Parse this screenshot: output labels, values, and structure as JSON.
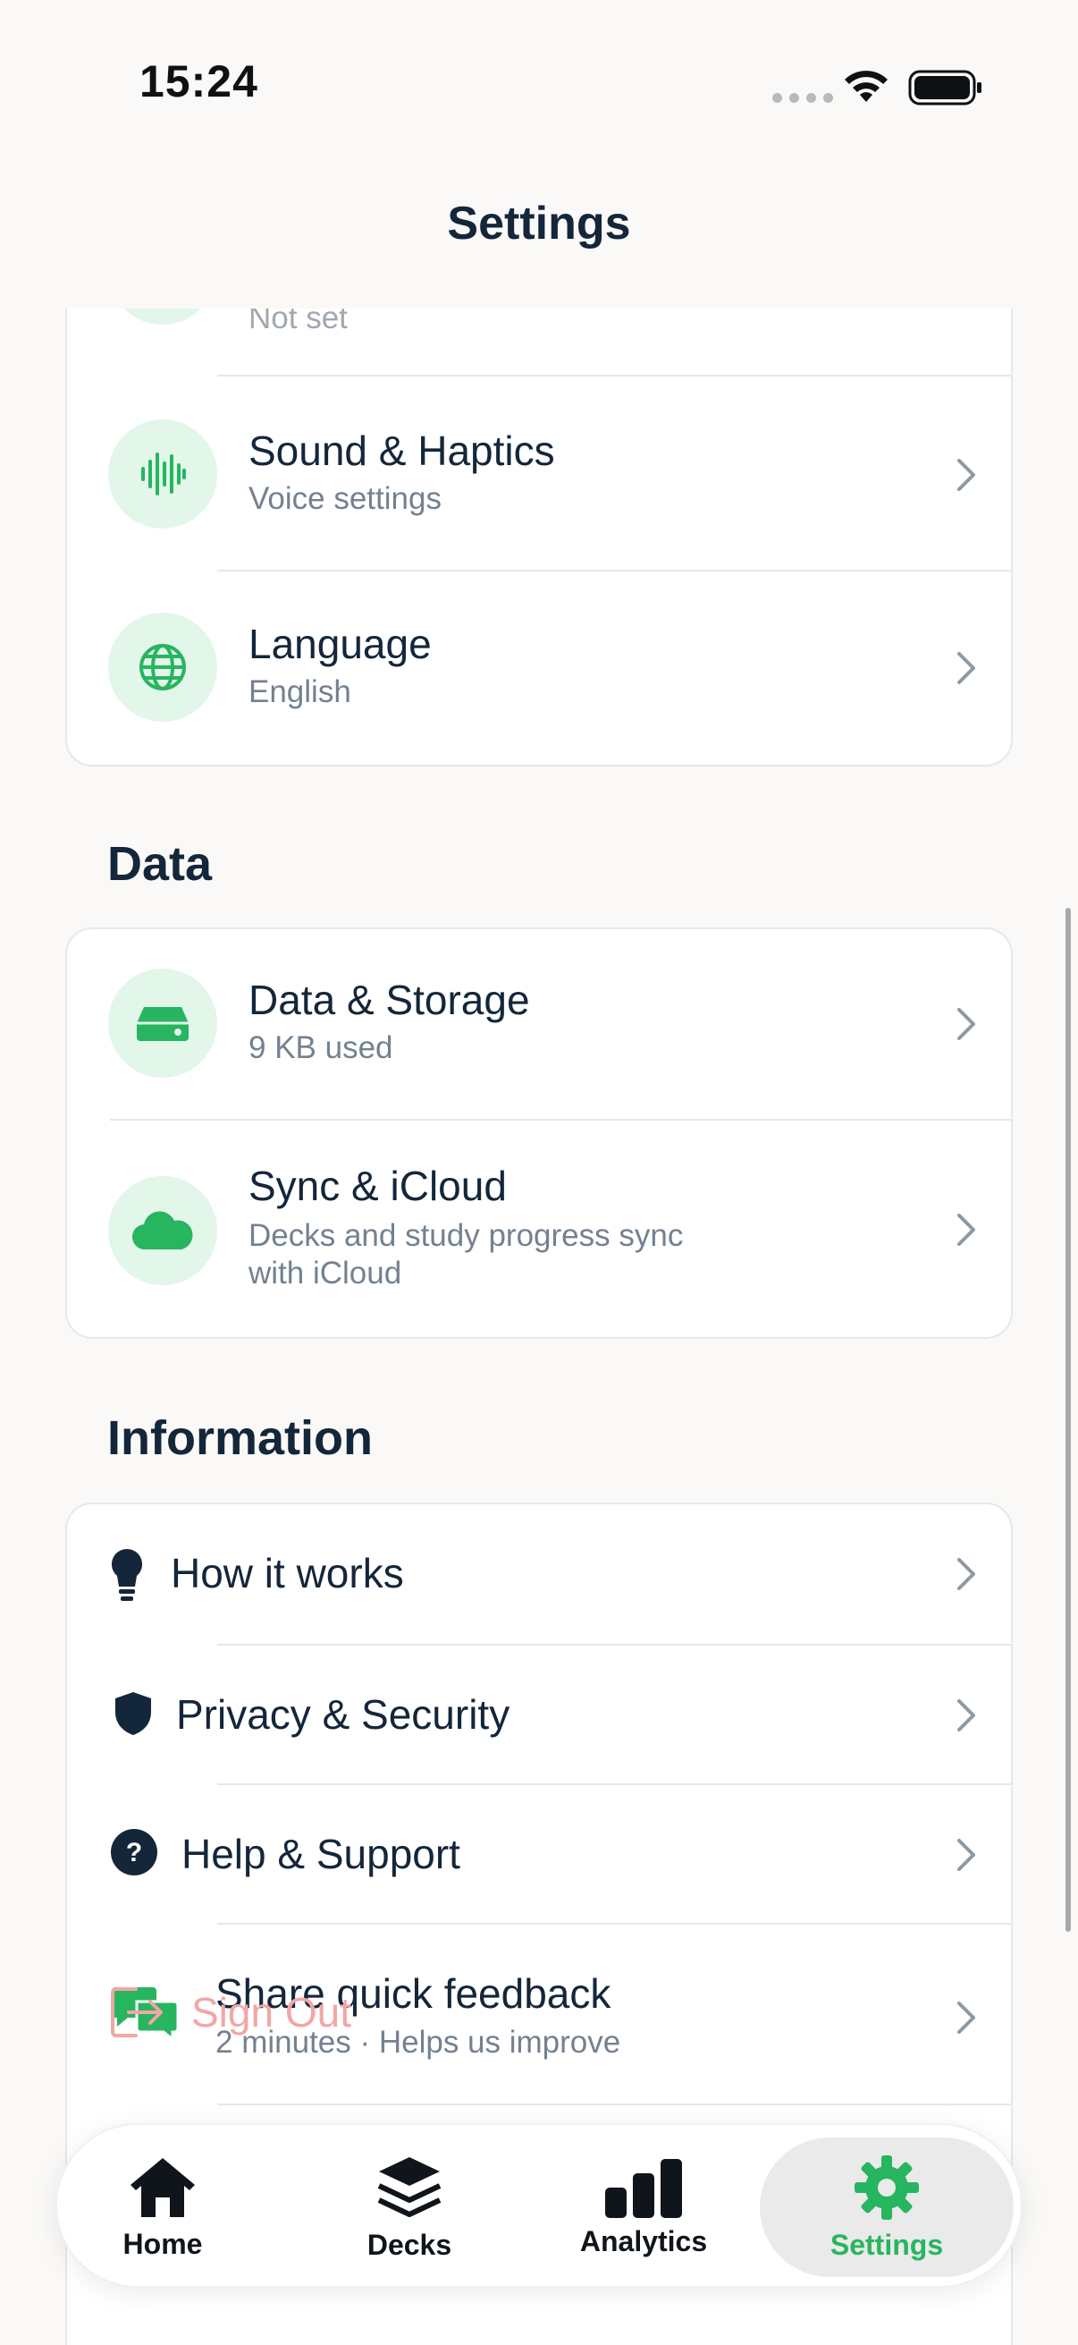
{
  "status_bar": {
    "time": "15:24"
  },
  "nav": {
    "title": "Settings"
  },
  "preferences": {
    "partial_row_sub": "Not set",
    "rows": [
      {
        "title": "Sound & Haptics",
        "subtitle": "Voice settings",
        "icon": "waveform-icon"
      },
      {
        "title": "Language",
        "subtitle": "English",
        "icon": "globe-icon"
      }
    ]
  },
  "data_section": {
    "header": "Data",
    "rows": [
      {
        "title": "Data & Storage",
        "subtitle": "9 KB used",
        "icon": "drive-icon"
      },
      {
        "title": "Sync & iCloud",
        "subtitle_line1": "Decks and study progress sync",
        "subtitle_line2": "with iCloud",
        "icon": "cloud-icon"
      }
    ]
  },
  "information_section": {
    "header": "Information",
    "rows": [
      {
        "title": "How it works",
        "icon": "lightbulb-icon"
      },
      {
        "title": "Privacy & Security",
        "icon": "shield-icon"
      },
      {
        "title": "Help & Support",
        "icon": "question-icon"
      },
      {
        "title": "Share quick feedback",
        "subtitle": "2 minutes · Helps us improve",
        "icon": "chat-bubbles-icon"
      }
    ]
  },
  "sign_out": {
    "label": "Sign Out"
  },
  "tab_bar": {
    "tabs": [
      {
        "label": "Home",
        "icon": "house-icon",
        "active": false
      },
      {
        "label": "Decks",
        "icon": "stack-icon",
        "active": false
      },
      {
        "label": "Analytics",
        "icon": "bar-chart-icon",
        "active": false
      },
      {
        "label": "Settings",
        "icon": "gear-icon",
        "active": true
      }
    ]
  },
  "colors": {
    "accent": "#27b55f",
    "icon_bg": "#e2f6ea",
    "text": "#14263a",
    "subtext": "#738190"
  }
}
